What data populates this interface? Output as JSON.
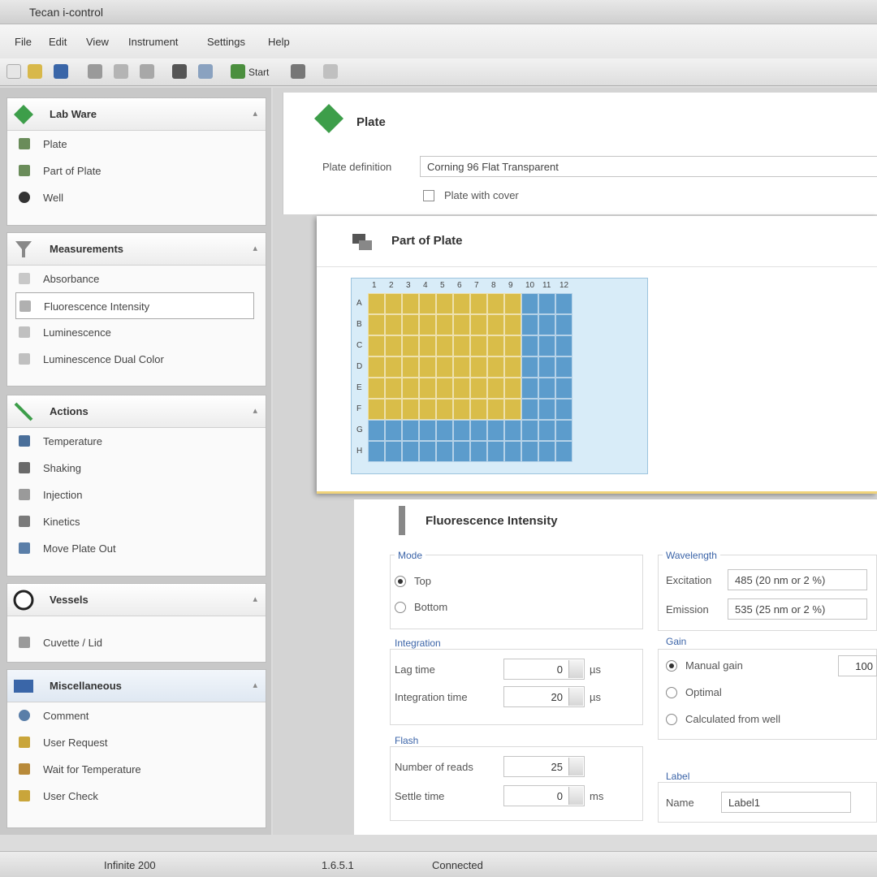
{
  "window": {
    "title": "Tecan i-control"
  },
  "menu": [
    "File",
    "Edit",
    "View",
    "Instrument",
    "Settings",
    "Help"
  ],
  "toolbar": {
    "run_label": "Start"
  },
  "sidebar": {
    "groups": [
      {
        "label": "Lab Ware",
        "icon": "plate-diamond-icon",
        "items": [
          "Plate",
          "Part of Plate",
          "Well"
        ]
      },
      {
        "label": "Measurements",
        "icon": "filter-icon",
        "items": [
          "Absorbance",
          "Fluorescence Intensity",
          "Luminescence",
          "Luminescence Dual Color"
        ]
      },
      {
        "label": "Actions",
        "icon": "pipette-icon",
        "items": [
          "Temperature",
          "Shaking",
          "Injection",
          "Kinetics",
          "Move Plate Out"
        ]
      },
      {
        "label": "Vessels",
        "icon": "vessel-icon",
        "items": [
          "Cuvette / Lid"
        ]
      },
      {
        "label": "Miscellaneous",
        "icon": "misc-icon",
        "items": [
          "Comment",
          "User Request",
          "Wait for Temperature",
          "User Check"
        ]
      }
    ],
    "selected_item": "Fluorescence Intensity"
  },
  "plate_panel": {
    "title": "Plate",
    "definition_label": "Plate definition",
    "definition_value": "Corning 96 Flat Transparent",
    "cover_label": "Plate with cover"
  },
  "part_panel": {
    "title": "Part of Plate",
    "column_labels": [
      "1",
      "2",
      "3",
      "4",
      "5",
      "6",
      "7",
      "8",
      "9",
      "10",
      "11",
      "12"
    ],
    "row_labels": [
      "A",
      "B",
      "C",
      "D",
      "E",
      "F",
      "G",
      "H"
    ],
    "selection": {
      "rows": 6,
      "cols": 9
    },
    "colors": {
      "selected": "#d9bd49",
      "unselected": "#5c9ccc"
    }
  },
  "fi_panel": {
    "title": "Fluorescence Intensity",
    "mode_label": "Mode",
    "mode_options": [
      "Top",
      "Bottom"
    ],
    "mode_selected": "Top",
    "wavelength_label": "Wavelength",
    "excitation_label": "Excitation",
    "excitation_value": "485 (20 nm or 2 %)",
    "emission_label": "Emission",
    "emission_value": "535 (25 nm or 2 %)",
    "integration_label": "Integration",
    "lag_label": "Lag time",
    "lag_value": "0",
    "lag_unit": "µs",
    "int_time_label": "Integration time",
    "int_time_value": "20",
    "int_time_unit": "µs",
    "flash_label": "Flash",
    "flash_number_label": "Number of reads",
    "flash_number_value": "25",
    "settle_label": "Settle time",
    "settle_value": "0",
    "settle_unit": "ms",
    "gain_label": "Gain",
    "gain_options": [
      "Manual gain",
      "Optimal",
      "Calculated from well"
    ],
    "gain_selected": "Manual gain",
    "gain_value": "100",
    "label_section": "Label",
    "name_label": "Name",
    "name_value": "Label1"
  },
  "status": {
    "left": "Infinite 200",
    "middle": "1.6.5.1",
    "right": "Connected"
  }
}
